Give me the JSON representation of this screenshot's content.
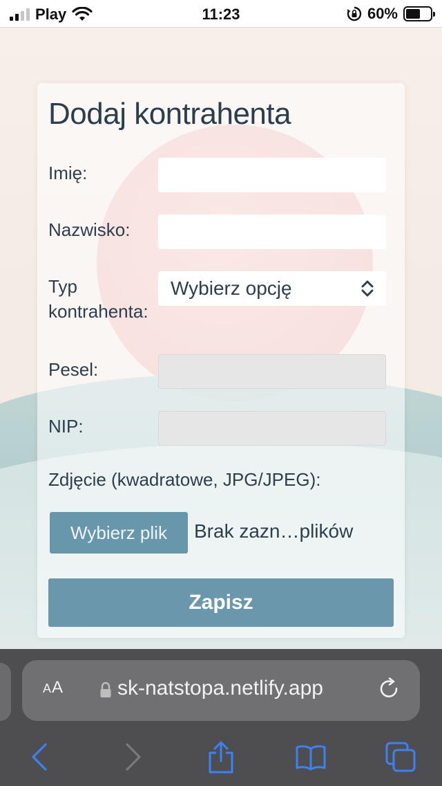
{
  "status_bar": {
    "carrier": "Play",
    "time": "11:23",
    "battery_percent": "60%",
    "battery_level": 0.6,
    "icons": [
      "signal-icon",
      "wifi-icon",
      "orientation-lock-icon",
      "battery-icon"
    ]
  },
  "form": {
    "title": "Dodaj kontrahenta",
    "first_name": {
      "label": "Imię:",
      "value": ""
    },
    "last_name": {
      "label": "Nazwisko:",
      "value": ""
    },
    "type": {
      "label_line1": "Typ",
      "label_line2": "kontrahenta:",
      "selected": "Wybierz opcję"
    },
    "pesel": {
      "label": "Pesel:",
      "value": ""
    },
    "nip": {
      "label": "NIP:",
      "value": ""
    },
    "photo": {
      "label": "Zdjęcie (kwadratowe, JPG/JPEG):",
      "button": "Wybierz plik",
      "status": "Brak zazn…plików"
    },
    "submit_label": "Zapisz"
  },
  "browser": {
    "text_size_label_small": "A",
    "text_size_label_large": "A",
    "url": "sk-natstopa.netlify.app",
    "icons": [
      "lock-icon",
      "reload-icon",
      "back-icon",
      "forward-icon",
      "share-icon",
      "bookmarks-icon",
      "tabs-icon"
    ]
  },
  "colors": {
    "accent_button": "#6896ab",
    "browser_chrome": "#4e4e50",
    "nav_icon_active": "#3b82f6",
    "nav_icon_disabled": "#7a7a7c"
  }
}
